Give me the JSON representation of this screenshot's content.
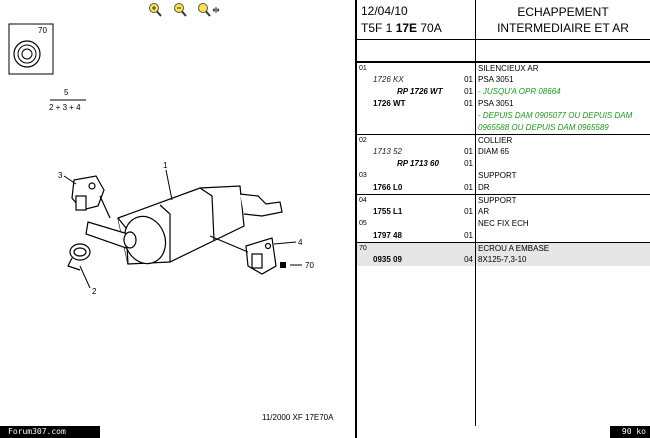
{
  "toolbar": {
    "zoom_in_icon": "zoom-in-icon",
    "zoom_out_icon": "zoom-out-icon",
    "pan_icon": "pan-icon"
  },
  "diagram": {
    "callout_70": "70",
    "callout_5": "5",
    "callout_formula": "2 + 3 + 4",
    "callout_1": "1",
    "callout_2": "2",
    "callout_3": "3",
    "callout_4": "4",
    "callout_70b": "70",
    "drawing_ref": "11/2000  XF 17E70A"
  },
  "header": {
    "date": "12/04/10",
    "code_prefix": "T5F 1 ",
    "code_bold": "17E",
    "code_suffix": " 70A",
    "title_line1": "ECHAPPEMENT",
    "title_line2": "INTERMEDIAIRE ET AR"
  },
  "rows": [
    {
      "grp": "01",
      "ref": "",
      "qty": "",
      "desc": "SILENCIEUX AR",
      "style": "cap",
      "sep": true
    },
    {
      "grp": "",
      "ref": "1726 KX",
      "qty": "01",
      "desc": "PSA 3051",
      "style": "it"
    },
    {
      "grp": "",
      "ref": "RP 1726 WT",
      "qty": "01",
      "desc": "- JUSQU'A OPR 08664",
      "style": "rp",
      "green": true
    },
    {
      "grp": "",
      "ref": "1726 WT",
      "qty": "01",
      "desc": "PSA 3051",
      "style": "bold"
    },
    {
      "grp": "",
      "ref": "",
      "qty": "",
      "desc": "- DEPUIS DAM 0905077 OU DEPUIS DAM",
      "green": true
    },
    {
      "grp": "",
      "ref": "",
      "qty": "",
      "desc": "0965588 OU DEPUIS DAM 0965589",
      "green": true
    },
    {
      "grp": "02",
      "ref": "",
      "qty": "",
      "desc": "COLLIER",
      "style": "cap",
      "sep": true
    },
    {
      "grp": "",
      "ref": "1713 52",
      "qty": "01",
      "desc": "DIAM 65",
      "style": "it"
    },
    {
      "grp": "",
      "ref": "RP 1713 60",
      "qty": "01",
      "desc": "",
      "style": "rp"
    },
    {
      "grp": "03",
      "ref": "",
      "qty": "",
      "desc": "SUPPORT",
      "style": "cap"
    },
    {
      "grp": "",
      "ref": "1766 L0",
      "qty": "01",
      "desc": "DR",
      "style": "bold"
    },
    {
      "grp": "04",
      "ref": "",
      "qty": "",
      "desc": "SUPPORT",
      "style": "cap",
      "sep": true
    },
    {
      "grp": "",
      "ref": "1755 L1",
      "qty": "01",
      "desc": "AR",
      "style": "bold"
    },
    {
      "grp": "05",
      "ref": "",
      "qty": "",
      "desc": "NEC FIX ECH",
      "style": "cap"
    },
    {
      "grp": "",
      "ref": "1797 48",
      "qty": "01",
      "desc": "",
      "style": "bold"
    },
    {
      "grp": "70",
      "ref": "",
      "qty": "",
      "desc": "ECROU A EMBASE",
      "style": "cap",
      "sep": true,
      "shade": true
    },
    {
      "grp": "",
      "ref": "0935 09",
      "qty": "04",
      "desc": "8X125-7,3-10",
      "style": "bold",
      "shade": true
    }
  ],
  "footer": {
    "left": "Forum307.com",
    "right": "90 ko"
  }
}
